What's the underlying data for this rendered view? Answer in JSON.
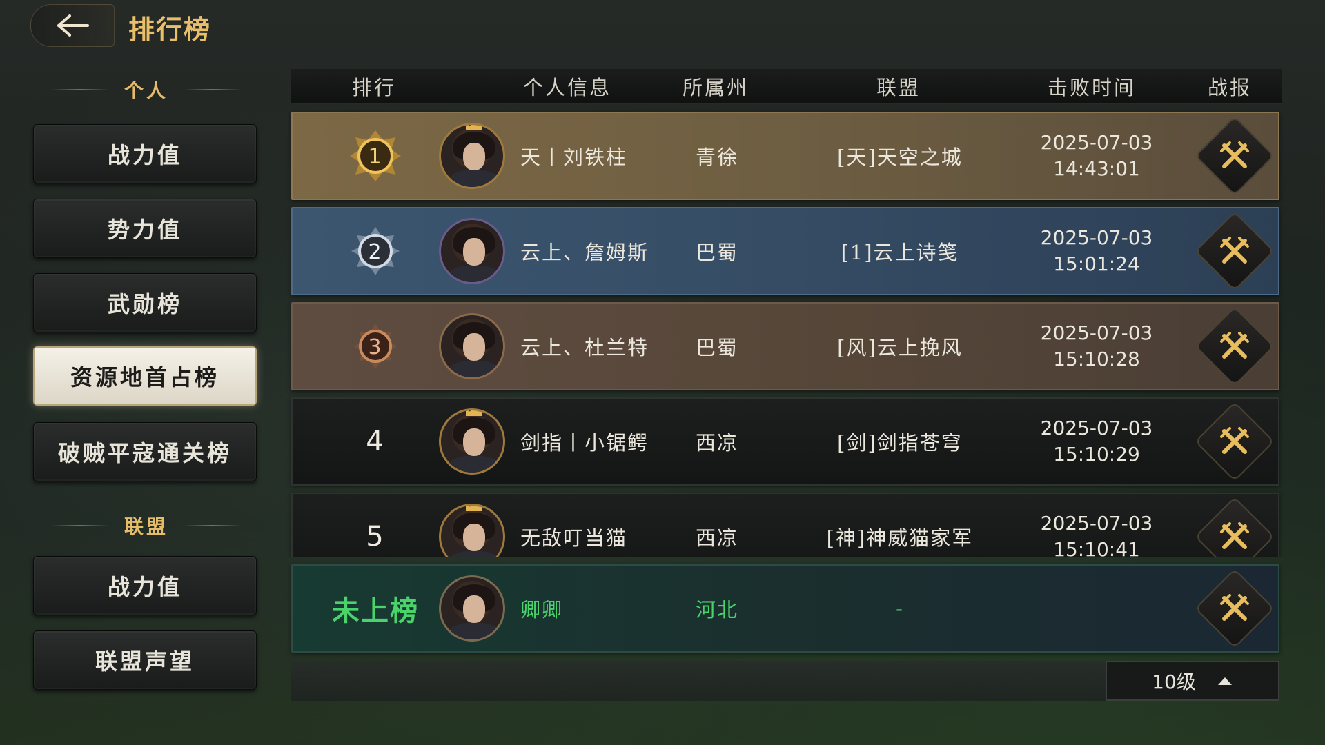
{
  "header": {
    "title": "排行榜"
  },
  "sidebar": {
    "personal_title": "个人",
    "personal_items": [
      {
        "label": "战力值"
      },
      {
        "label": "势力值"
      },
      {
        "label": "武勋榜"
      },
      {
        "label": "资源地首占榜",
        "active": true
      },
      {
        "label": "破贼平寇通关榜"
      }
    ],
    "alliance_title": "联盟",
    "alliance_items": [
      {
        "label": "战力值"
      },
      {
        "label": "联盟声望"
      }
    ]
  },
  "table": {
    "columns": [
      "排行",
      "个人信息",
      "所属州",
      "联盟",
      "击败时间",
      "战报"
    ],
    "rows": [
      {
        "rank": "1",
        "name": "天丨刘铁柱",
        "state": "青徐",
        "alliance": "[天]天空之城",
        "date": "2025-07-03",
        "time": "14:43:01"
      },
      {
        "rank": "2",
        "name": "云上、詹姆斯",
        "state": "巴蜀",
        "alliance": "[1]云上诗笺",
        "date": "2025-07-03",
        "time": "15:01:24"
      },
      {
        "rank": "3",
        "name": "云上、杜兰特",
        "state": "巴蜀",
        "alliance": "[风]云上挽风",
        "date": "2025-07-03",
        "time": "15:10:28"
      },
      {
        "rank": "4",
        "name": "剑指丨小锯鳄",
        "state": "西凉",
        "alliance": "[剑]剑指苍穹",
        "date": "2025-07-03",
        "time": "15:10:29"
      },
      {
        "rank": "5",
        "name": "无敌叮当猫",
        "state": "西凉",
        "alliance": "[神]神威猫家军",
        "date": "2025-07-03",
        "time": "15:10:41"
      }
    ],
    "self_row": {
      "rank": "未上榜",
      "name": "卿卿",
      "state": "河北",
      "alliance": "-"
    }
  },
  "footer": {
    "level": "10级"
  },
  "colors": {
    "gold": "#e9bf6c",
    "self_green": "#49d36a"
  }
}
